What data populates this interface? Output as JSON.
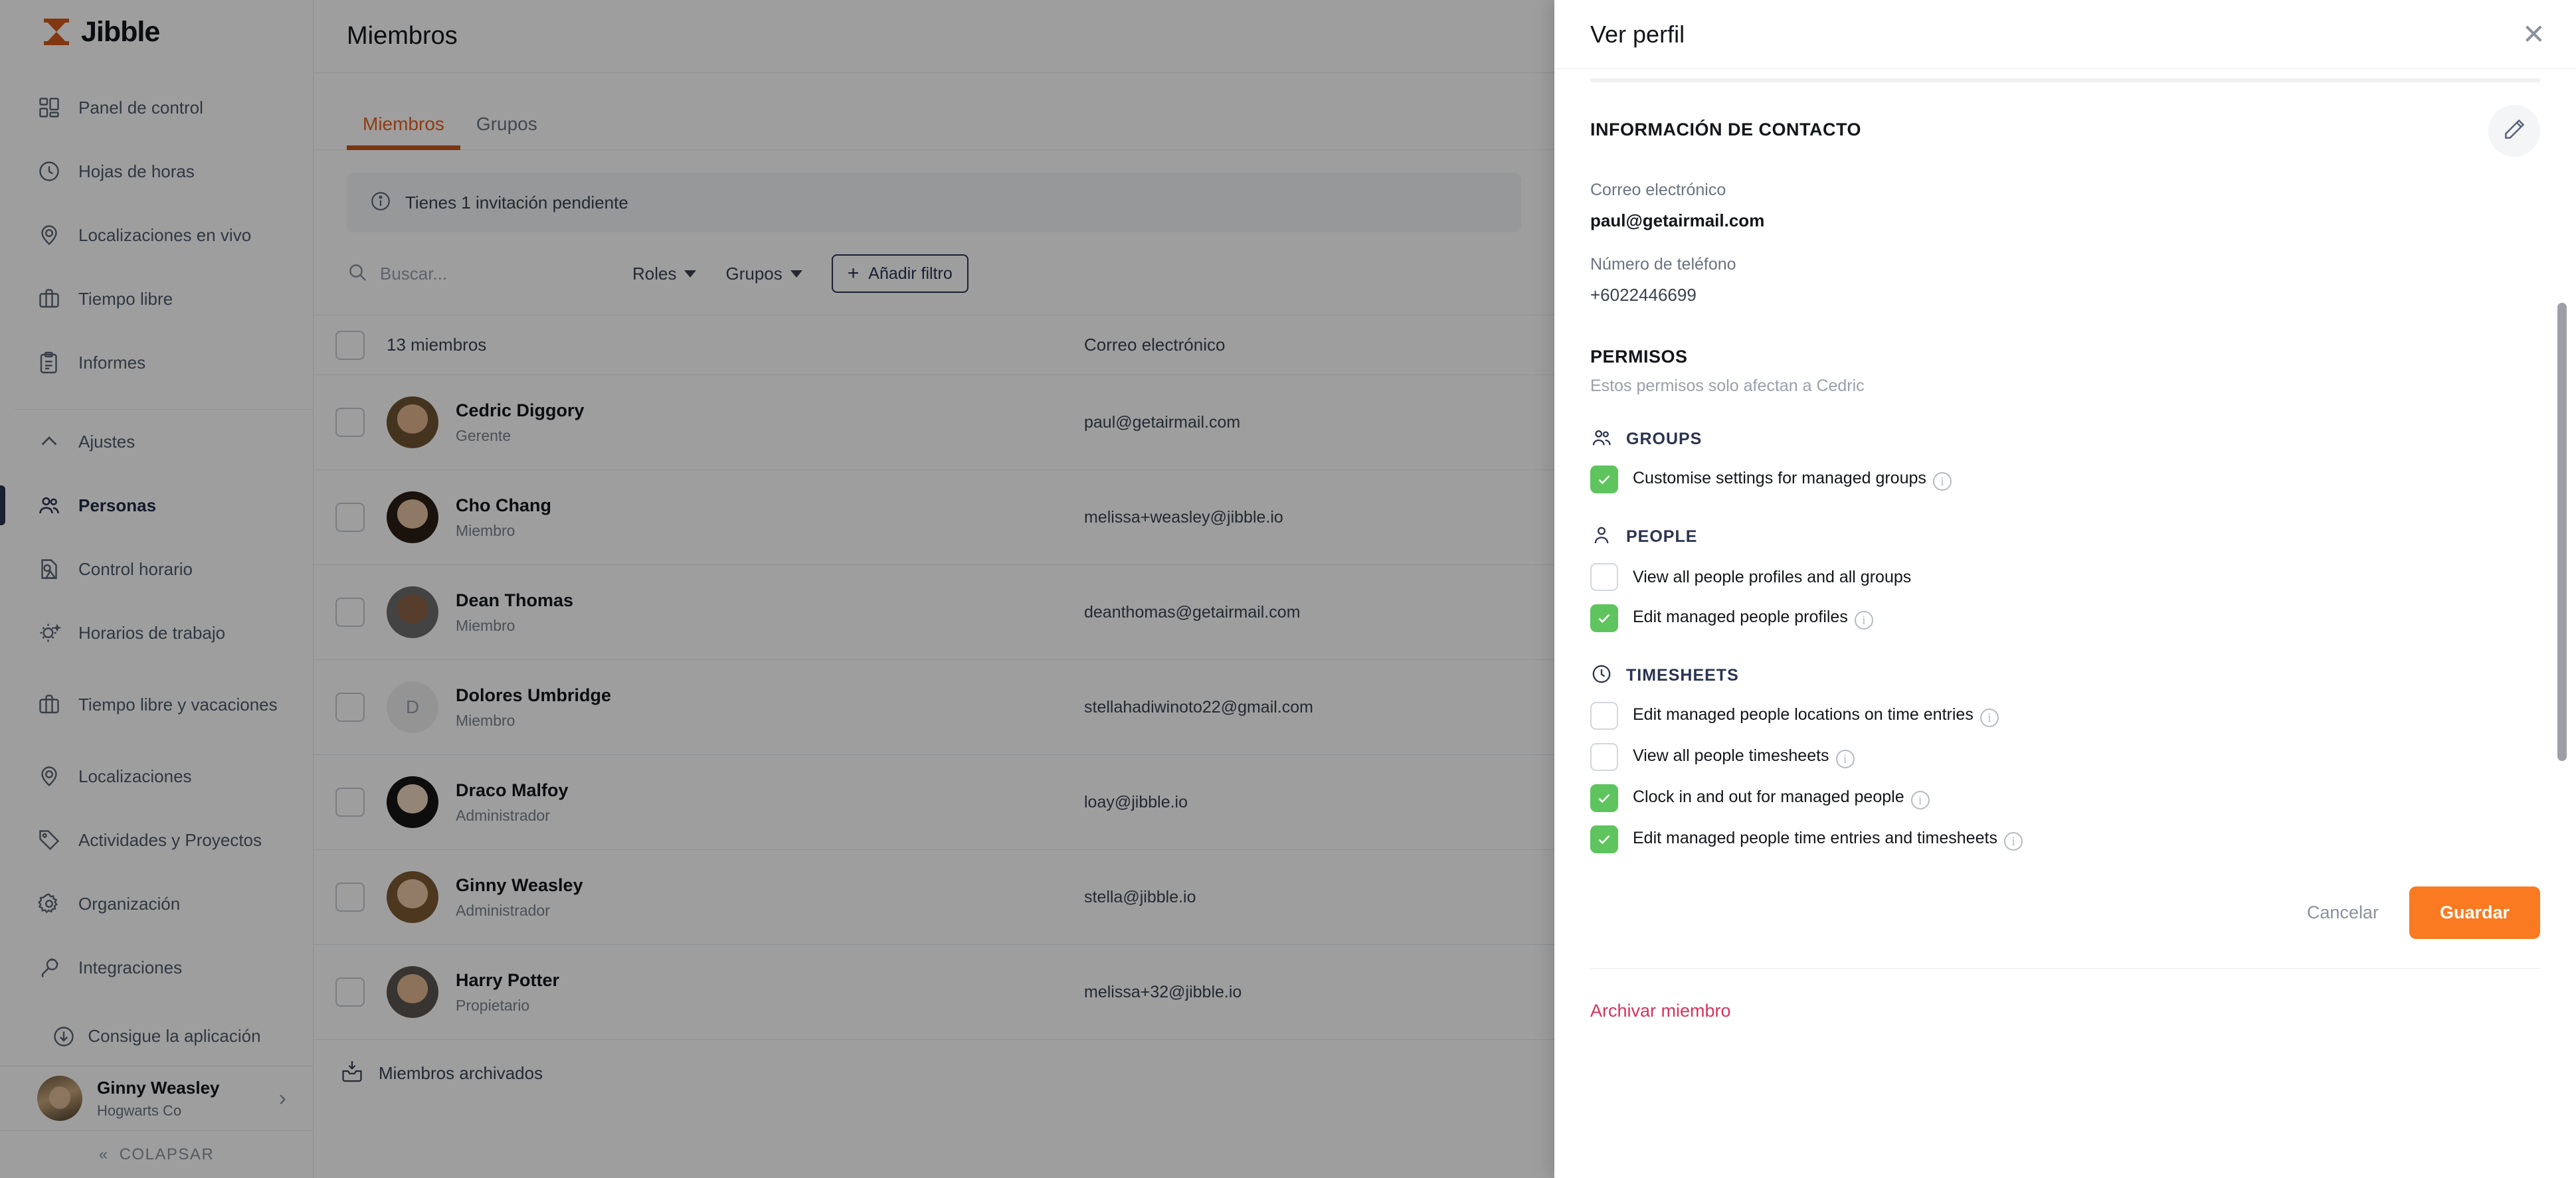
{
  "brand": {
    "name": "Jibble"
  },
  "sidebar": {
    "groups": [
      {
        "items": [
          {
            "label": "Panel de control",
            "icon": "dashboard-icon"
          },
          {
            "label": "Hojas de horas",
            "icon": "clock-icon"
          },
          {
            "label": "Localizaciones en vivo",
            "icon": "map-pin-icon"
          },
          {
            "label": "Tiempo libre",
            "icon": "briefcase-icon"
          },
          {
            "label": "Informes",
            "icon": "clipboard-icon"
          }
        ]
      },
      {
        "items": [
          {
            "label": "Ajustes",
            "icon": "chevron-up-icon"
          },
          {
            "label": "Personas",
            "icon": "people-icon",
            "active": true
          },
          {
            "label": "Control horario",
            "icon": "time-control-icon"
          },
          {
            "label": "Horarios de trabajo",
            "icon": "schedule-icon"
          },
          {
            "label": "Tiempo libre y vacaciones",
            "icon": "briefcase-icon"
          },
          {
            "label": "Localizaciones",
            "icon": "map-pin-icon"
          },
          {
            "label": "Actividades y Proyectos",
            "icon": "tag-icon"
          },
          {
            "label": "Organización",
            "icon": "gear-icon"
          },
          {
            "label": "Integraciones",
            "icon": "plug-icon"
          }
        ]
      }
    ],
    "get_app": "Consigue la aplicación",
    "user": {
      "name": "Ginny Weasley",
      "org": "Hogwarts Co"
    },
    "collapse": "COLAPSAR"
  },
  "main": {
    "page_title": "Miembros",
    "tabs": [
      {
        "label": "Miembros",
        "active": true
      },
      {
        "label": "Grupos",
        "active": false
      }
    ],
    "banner": "Tienes 1 invitación pendiente",
    "search_placeholder": "Buscar...",
    "filters": [
      {
        "label": "Roles"
      },
      {
        "label": "Grupos"
      }
    ],
    "add_filter": "Añadir filtro",
    "table": {
      "count_label": "13 miembros",
      "email_header": "Correo electrónico",
      "rows": [
        {
          "name": "Cedric Diggory",
          "role": "Gerente",
          "email": "paul@getairmail.com",
          "avatar": "photo",
          "skin": "#e0b48f",
          "hair": "#6b4a2a"
        },
        {
          "name": "Cho Chang",
          "role": "Miembro",
          "email": "melissa+weasley@jibble.io",
          "avatar": "photo",
          "skin": "#e4c0a0",
          "hair": "#1a1210"
        },
        {
          "name": "Dean Thomas",
          "role": "Miembro",
          "email": "deanthomas@getairmail.com",
          "avatar": "photo",
          "skin": "#8d6346",
          "hair": "#241a13"
        },
        {
          "name": "Dolores Umbridge",
          "role": "Miembro",
          "email": "stellahadiwinoto22@gmail.com",
          "avatar": "initial",
          "initial": "D"
        },
        {
          "name": "Draco Malfoy",
          "role": "Administrador",
          "email": "loay@jibble.io",
          "avatar": "photo",
          "skin": "#eed7c0",
          "hair": "#e8dfbe"
        },
        {
          "name": "Ginny Weasley",
          "role": "Administrador",
          "email": "stella@jibble.io",
          "avatar": "photo",
          "skin": "#eac6a4",
          "hair": "#8a5a2b"
        },
        {
          "name": "Harry Potter",
          "role": "Propietario",
          "email": "melissa+32@jibble.io",
          "avatar": "photo",
          "skin": "#e2b894",
          "hair": "#2b2019"
        }
      ]
    },
    "archived_label": "Miembros archivados"
  },
  "panel": {
    "title": "Ver perfil",
    "close_icon": "close-icon",
    "contact": {
      "section_title": "INFORMACIÓN DE CONTACTO",
      "edit_icon": "pencil-icon",
      "email_label": "Correo electrónico",
      "email_value": "paul@getairmail.com",
      "phone_label": "Número de teléfono",
      "phone_value": "+6022446699"
    },
    "permissions": {
      "title": "PERMISOS",
      "subtitle": "Estos permisos solo afectan a Cedric",
      "groups": [
        {
          "icon": "people-icon",
          "label": "GROUPS",
          "items": [
            {
              "label": "Customise settings for managed groups",
              "checked": true,
              "info": true
            }
          ]
        },
        {
          "icon": "person-icon",
          "label": "PEOPLE",
          "items": [
            {
              "label": "View all people profiles and all groups",
              "checked": false,
              "info": false
            },
            {
              "label": "Edit managed people profiles",
              "checked": true,
              "info": true
            }
          ]
        },
        {
          "icon": "clock-icon",
          "label": "TIMESHEETS",
          "items": [
            {
              "label": "Edit managed people locations on time entries",
              "checked": false,
              "info": true
            },
            {
              "label": "View all people timesheets",
              "checked": false,
              "info": true
            },
            {
              "label": "Clock in and out for managed people",
              "checked": true,
              "info": true
            },
            {
              "label": "Edit managed people time entries and timesheets",
              "checked": true,
              "info": true
            }
          ]
        }
      ]
    },
    "cancel_label": "Cancelar",
    "save_label": "Guardar",
    "archive_label": "Archivar miembro"
  },
  "colors": {
    "brand_orange": "#e8601c",
    "save_orange": "#f97a21",
    "check_green": "#5ec45e",
    "danger_red": "#d6335c",
    "navy": "#2a3350"
  }
}
